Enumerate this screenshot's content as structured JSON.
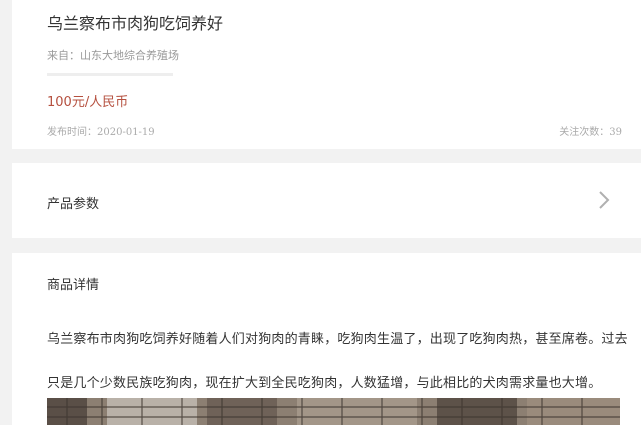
{
  "product": {
    "title": "乌兰察布市肉狗吃饲养好",
    "source": "来自：山东大地综合养殖场",
    "price": "100元/人民币",
    "published": "发布时间：2020-01-19",
    "follow_count": "关注次数：39"
  },
  "params": {
    "label": "产品参数",
    "icon": "chevron-right-icon"
  },
  "detail": {
    "heading": "商品详情",
    "text": "乌兰察布市肉狗吃饲养好随着人们对狗肉的青睐，吃狗肉生温了，出现了吃狗肉热，甚至席卷。过去只是几个少数民族吃狗肉，现在扩大到全民吃狗肉，人数猛增，与此相比的犬肉需求量也大增。"
  },
  "colors": {
    "price": "#b5503f",
    "background": "#f2f2f2",
    "card": "#ffffff"
  }
}
